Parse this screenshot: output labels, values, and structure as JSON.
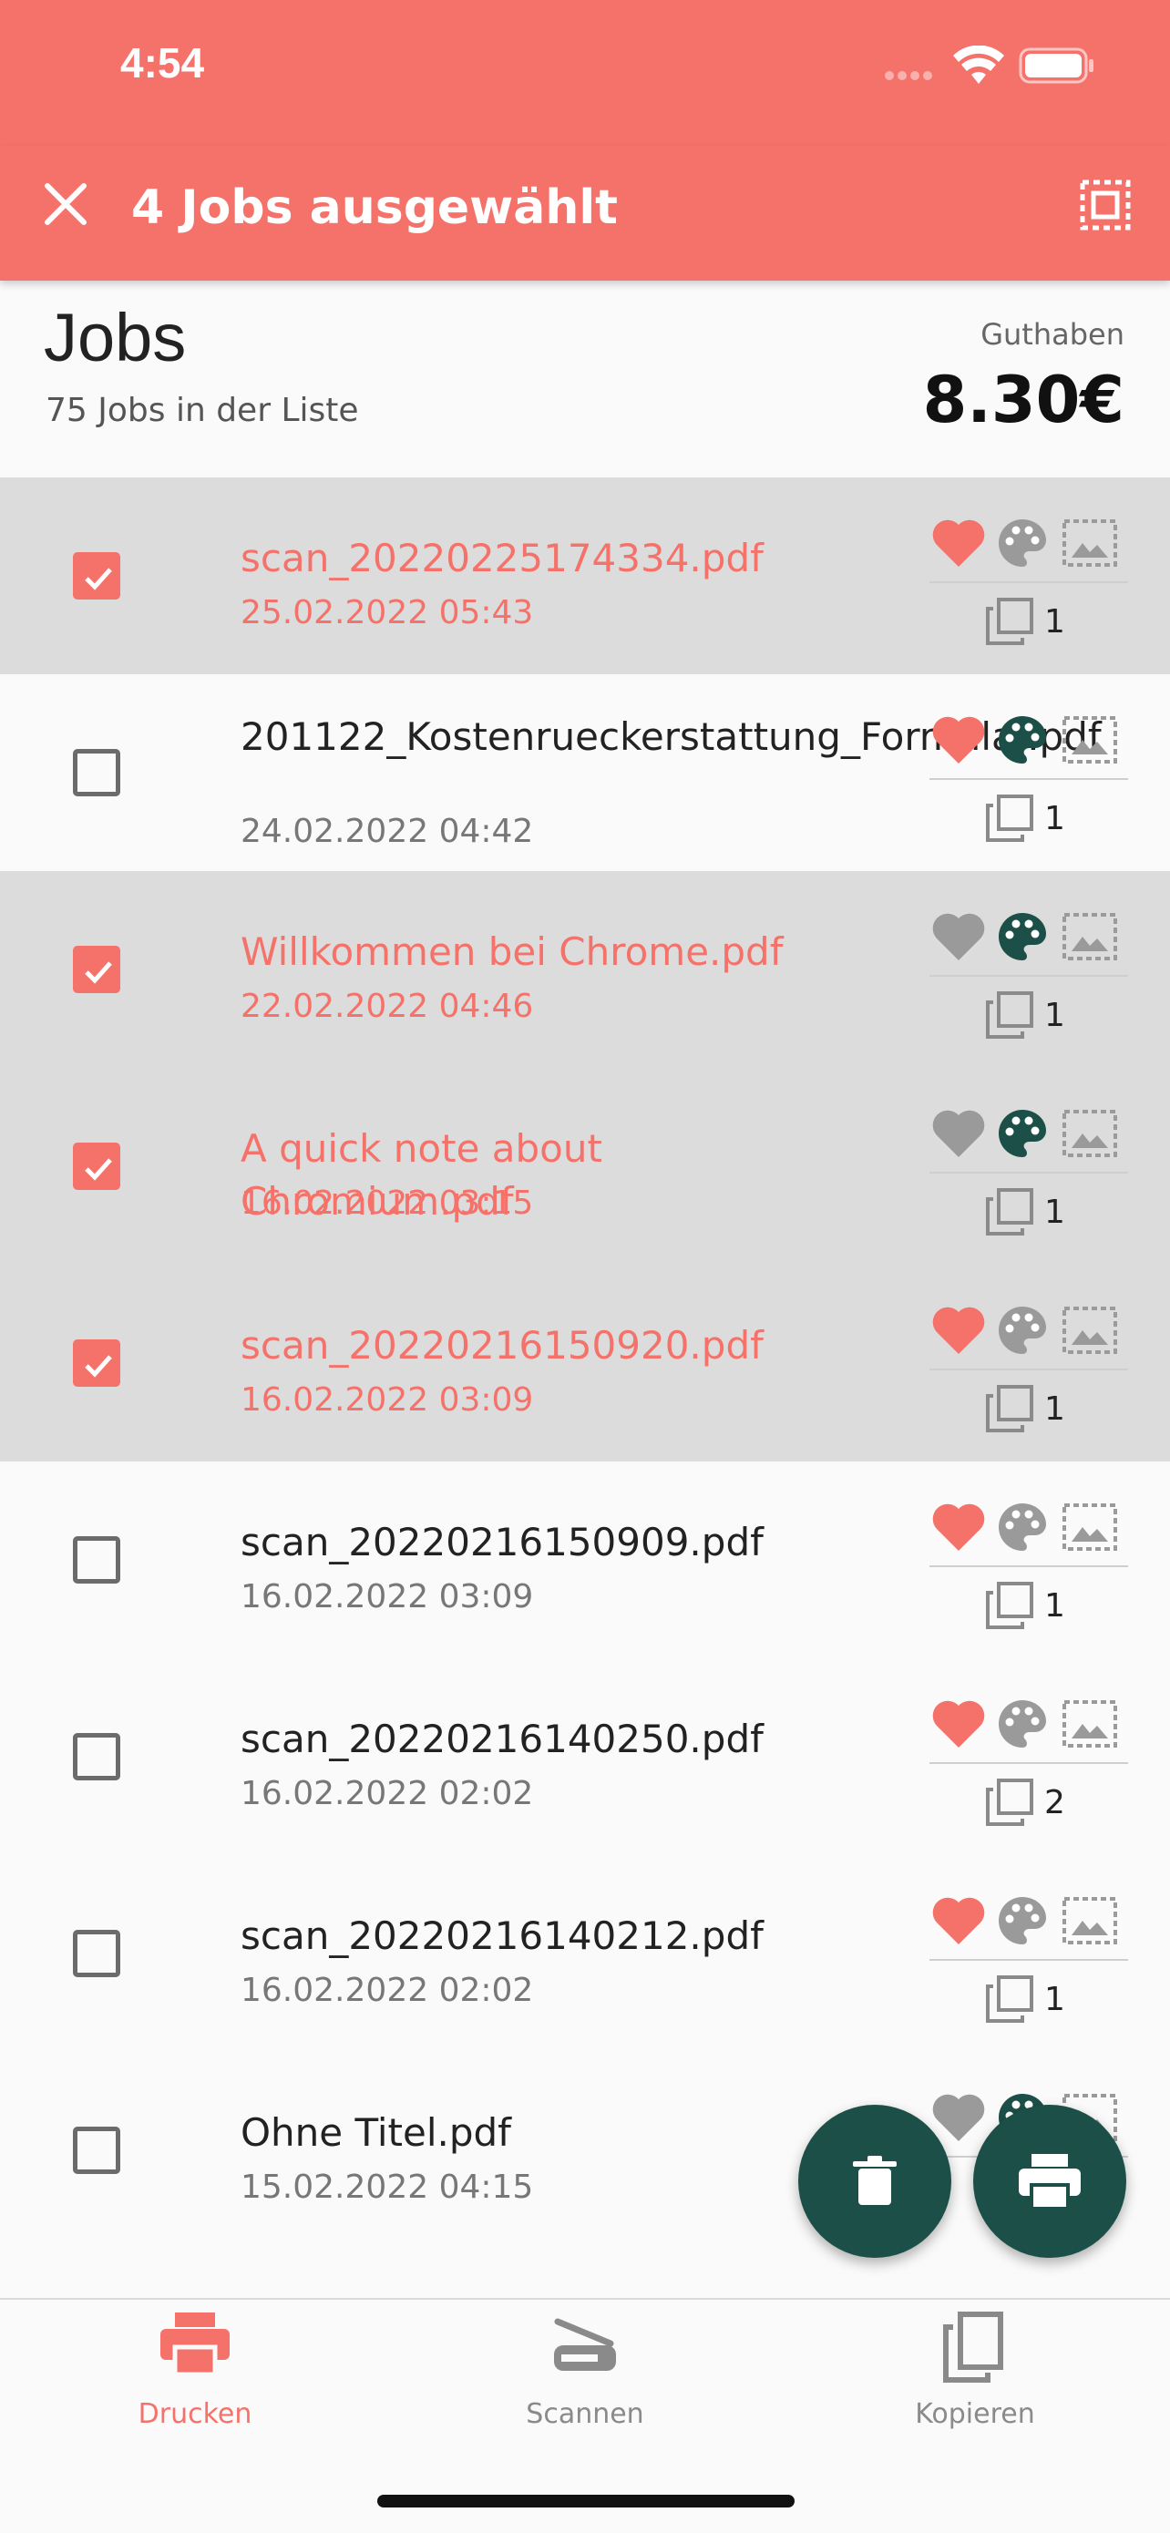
{
  "status": {
    "time": "4:54"
  },
  "appbar": {
    "title": "4 Jobs ausgewählt"
  },
  "header": {
    "title": "Jobs",
    "subtitle": "75 Jobs in der Liste",
    "balance_label": "Guthaben",
    "balance": "8.30€"
  },
  "colors": {
    "accent": "#f5726a",
    "dark_green": "#1b4f48",
    "selected_row": "#dcdcdc"
  },
  "jobs": [
    {
      "name": "scan_20220225174334.pdf",
      "date": "25.02.2022 05:43",
      "selected": true,
      "favorite": true,
      "color": false,
      "copies": "1"
    },
    {
      "name": "201122_Kostenrueckerstattung_Formular.pdf",
      "date": "24.02.2022 04:42",
      "selected": false,
      "favorite": true,
      "color": true,
      "copies": "1"
    },
    {
      "name": "Willkommen bei Chrome.pdf",
      "date": "22.02.2022 04:46",
      "selected": true,
      "favorite": false,
      "color": true,
      "copies": "1"
    },
    {
      "name": "A quick note about Chromium.pdf",
      "date": "16.02.2022 03:15",
      "selected": true,
      "favorite": false,
      "color": true,
      "copies": "1"
    },
    {
      "name": "scan_20220216150920.pdf",
      "date": "16.02.2022 03:09",
      "selected": true,
      "favorite": true,
      "color": false,
      "copies": "1"
    },
    {
      "name": "scan_20220216150909.pdf",
      "date": "16.02.2022 03:09",
      "selected": false,
      "favorite": true,
      "color": false,
      "copies": "1"
    },
    {
      "name": "scan_20220216140250.pdf",
      "date": "16.02.2022 02:02",
      "selected": false,
      "favorite": true,
      "color": false,
      "copies": "2"
    },
    {
      "name": "scan_20220216140212.pdf",
      "date": "16.02.2022 02:02",
      "selected": false,
      "favorite": true,
      "color": false,
      "copies": "1"
    },
    {
      "name": "Ohne Titel.pdf",
      "date": "15.02.2022 04:15",
      "selected": false,
      "favorite": false,
      "color": true,
      "copies": ""
    }
  ],
  "nav": [
    {
      "label": "Drucken",
      "icon": "printer-icon",
      "active": true
    },
    {
      "label": "Scannen",
      "icon": "scanner-icon",
      "active": false
    },
    {
      "label": "Kopieren",
      "icon": "copy-icon",
      "active": false
    }
  ]
}
